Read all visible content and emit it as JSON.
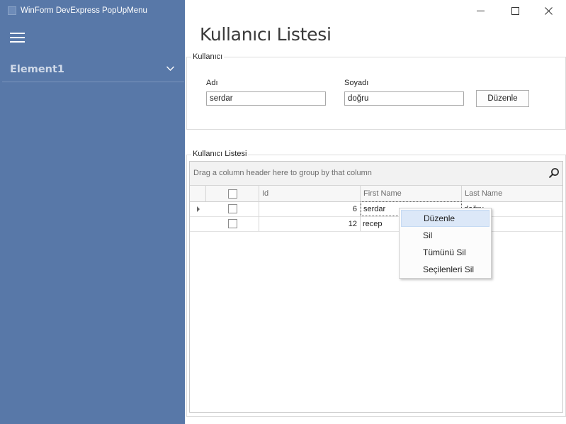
{
  "window": {
    "title": "WinForm DevExpress PopUpMenu",
    "controls": [
      "minimize",
      "maximize",
      "close"
    ]
  },
  "sidebar": {
    "menu_icon": "hamburger-icon",
    "items": [
      {
        "label": "Element1",
        "icon": "chevron-down-icon"
      }
    ]
  },
  "page": {
    "title": "Kullanıcı Listesi"
  },
  "user_form": {
    "group_title": "Kullanıcı",
    "first_name": {
      "label": "Adı",
      "value": "serdar"
    },
    "last_name": {
      "label": "Soyadı",
      "value": "doğru"
    },
    "edit_button": "Düzenle"
  },
  "grid": {
    "group_title": "Kullanıcı Listesi",
    "group_panel_hint": "Drag a column header here to group by that column",
    "search_icon": "search-icon",
    "columns": [
      "",
      "Id",
      "First Name",
      "Last Name"
    ],
    "rows": [
      {
        "checked": false,
        "id": "6",
        "first_name": "serdar",
        "last_name": "doğru",
        "focused": true
      },
      {
        "checked": false,
        "id": "12",
        "first_name": "recep",
        "last_name": ""
      }
    ]
  },
  "context_menu": {
    "items": [
      "Düzenle",
      "Sil",
      "Tümünü Sil",
      "Seçilenleri Sil"
    ],
    "highlighted_index": 0
  },
  "colors": {
    "sidebar_bg": "#5878a8",
    "menu_highlight": "#dce8f8"
  }
}
